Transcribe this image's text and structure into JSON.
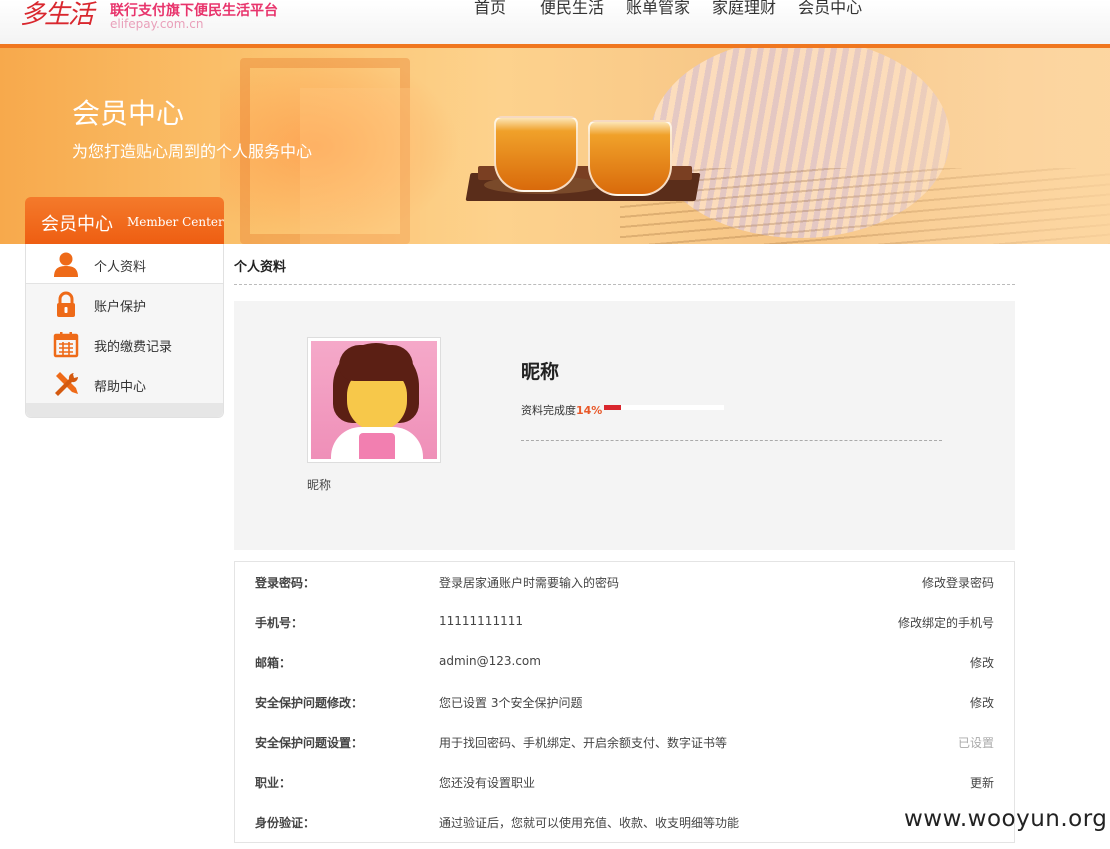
{
  "header": {
    "logo_text": "多生活",
    "logo_tagline": "联行支付旗下便民生活平台",
    "logo_url": "elifepay.com.cn",
    "nav": [
      "首页",
      "便民生活",
      "账单管家",
      "家庭理财",
      "会员中心"
    ]
  },
  "banner": {
    "title": "会员中心",
    "subtitle": "为您打造贴心周到的个人服务中心"
  },
  "sidebar": {
    "title_cn": "会员中心",
    "title_en": "Member Center",
    "items": [
      {
        "label": "个人资料",
        "icon": "person-icon",
        "active": true
      },
      {
        "label": "账户保护",
        "icon": "lock-icon",
        "active": false
      },
      {
        "label": "我的缴费记录",
        "icon": "calendar-icon",
        "active": false
      },
      {
        "label": "帮助中心",
        "icon": "tools-icon",
        "active": false
      }
    ]
  },
  "main": {
    "section_title": "个人资料",
    "profile": {
      "nickname_caption": "昵称",
      "nickname": "昵称",
      "completion_label": "资料完成度",
      "completion_pct_text": "14%",
      "completion_value": 0.14
    },
    "info_rows": [
      {
        "label": "登录密码：",
        "value": "登录居家通账户时需要输入的密码",
        "action": "修改登录密码",
        "muted": false
      },
      {
        "label": "手机号：",
        "value": "11111111111",
        "action": "修改绑定的手机号",
        "muted": false
      },
      {
        "label": "邮箱：",
        "value": "admin@123.com",
        "action": "修改",
        "muted": false
      },
      {
        "label": "安全保护问题修改：",
        "value": "您已设置 3个安全保护问题",
        "action": "修改",
        "muted": false
      },
      {
        "label": "安全保护问题设置：",
        "value": "用于找回密码、手机绑定、开启余额支付、数字证书等",
        "action": "已设置",
        "muted": true
      },
      {
        "label": "职业：",
        "value": "您还没有设置职业",
        "action": "更新",
        "muted": false
      },
      {
        "label": "身份验证：",
        "value": "通过验证后，您就可以使用充值、收款、收支明细等功能",
        "action": "",
        "muted": false
      }
    ]
  },
  "watermark": "www.wooyun.org",
  "colors": {
    "accent": "#f0771f",
    "completion_bar": "#d9272e",
    "completion_text": "#e8592a",
    "icon_orange": "#ee6a18"
  }
}
